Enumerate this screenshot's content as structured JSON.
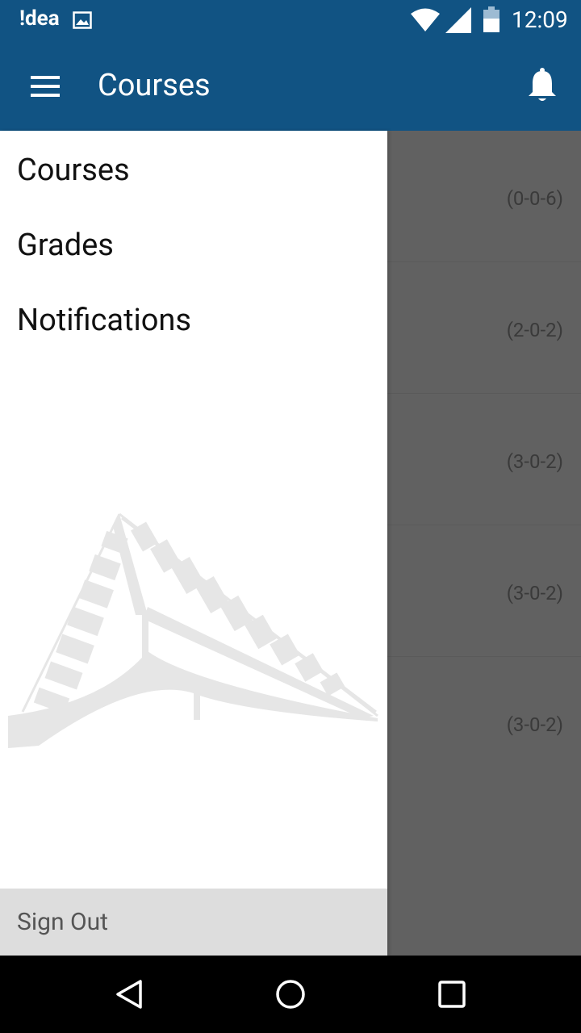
{
  "status_bar": {
    "carrier": "!dea",
    "time": "12:09"
  },
  "app_bar": {
    "title": "Courses"
  },
  "drawer": {
    "items": [
      {
        "label": "Courses"
      },
      {
        "label": "Grades"
      },
      {
        "label": "Notifications"
      }
    ],
    "signout_label": "Sign Out"
  },
  "courses": [
    {
      "credits": "(0-0-6)"
    },
    {
      "credits": "(2-0-2)"
    },
    {
      "credits": "(3-0-2)"
    },
    {
      "credits": "(3-0-2)"
    },
    {
      "credits": "(3-0-2)"
    }
  ],
  "colors": {
    "primary": "#115383",
    "scrim": "#616161",
    "signout_bg": "#dddddd"
  },
  "icons": [
    "gallery-icon",
    "wifi-icon",
    "signal-icon",
    "battery-icon",
    "menu-icon",
    "bell-icon",
    "back-icon",
    "home-icon",
    "recents-icon"
  ]
}
